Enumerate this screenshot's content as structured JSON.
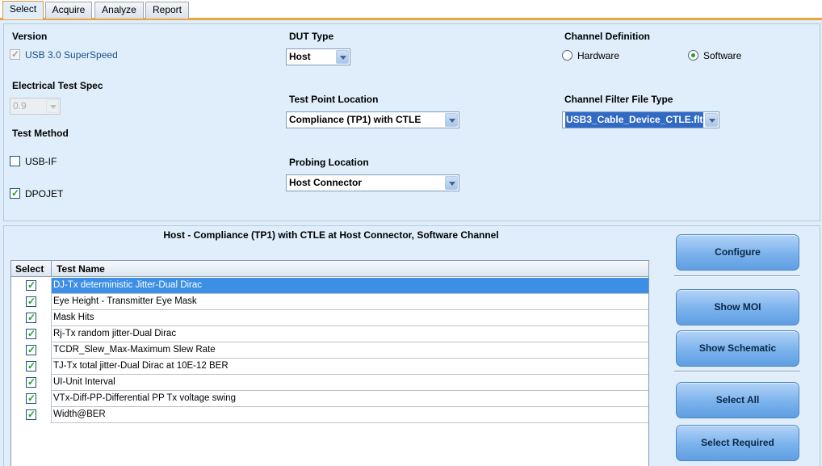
{
  "tabs": [
    {
      "label": "Select",
      "active": true
    },
    {
      "label": "Acquire",
      "active": false
    },
    {
      "label": "Analyze",
      "active": false
    },
    {
      "label": "Report",
      "active": false
    }
  ],
  "config": {
    "version": {
      "label": "Version",
      "option_label": "USB 3.0 SuperSpeed",
      "checked": true,
      "enabled": false
    },
    "electrical_test_spec": {
      "label": "Electrical Test Spec",
      "value": "0.9",
      "enabled": false
    },
    "test_method": {
      "label": "Test Method",
      "options": [
        {
          "label": "USB-IF",
          "checked": false
        },
        {
          "label": "DPOJET",
          "checked": true
        }
      ]
    },
    "dut_type": {
      "label": "DUT Type",
      "value": "Host"
    },
    "test_point_location": {
      "label": "Test Point Location",
      "value": "Compliance (TP1) with CTLE"
    },
    "probing_location": {
      "label": "Probing Location",
      "value": "Host Connector"
    },
    "channel_definition": {
      "label": "Channel Definition",
      "options": [
        {
          "label": "Hardware",
          "selected": false
        },
        {
          "label": "Software",
          "selected": true
        }
      ]
    },
    "channel_filter_file_type": {
      "label": "Channel Filter File Type",
      "value": "USB3_Cable_Device_CTLE.flt"
    }
  },
  "results": {
    "caption": "Host - Compliance (TP1) with CTLE at Host Connector, Software Channel",
    "columns": {
      "select": "Select",
      "test_name": "Test Name"
    },
    "rows": [
      {
        "name": "DJ-Tx deterministic Jitter-Dual Dirac",
        "checked": true,
        "selected": true
      },
      {
        "name": "Eye Height - Transmitter Eye Mask",
        "checked": true,
        "selected": false
      },
      {
        "name": "Mask Hits",
        "checked": true,
        "selected": false
      },
      {
        "name": "Rj-Tx random jitter-Dual Dirac",
        "checked": true,
        "selected": false
      },
      {
        "name": "TCDR_Slew_Max-Maximum Slew Rate",
        "checked": true,
        "selected": false
      },
      {
        "name": "TJ-Tx total jitter-Dual Dirac at 10E-12 BER",
        "checked": true,
        "selected": false
      },
      {
        "name": "UI-Unit Interval",
        "checked": true,
        "selected": false
      },
      {
        "name": "VTx-Diff-PP-Differential PP Tx voltage swing",
        "checked": true,
        "selected": false
      },
      {
        "name": "Width@BER",
        "checked": true,
        "selected": false
      }
    ]
  },
  "buttons": {
    "configure": "Configure",
    "show_moi": "Show  MOI",
    "show_schematic": "Show Schematic",
    "select_all": "Select All",
    "select_required": "Select Required"
  },
  "colors": {
    "panel_bg": "#dfeefa",
    "tab_accent": "#f0a43c",
    "selected_row": "#3d8ee5",
    "check_green": "#21a121"
  },
  "icons": {
    "check": "check-icon",
    "dropdown": "chevron-down-icon"
  }
}
